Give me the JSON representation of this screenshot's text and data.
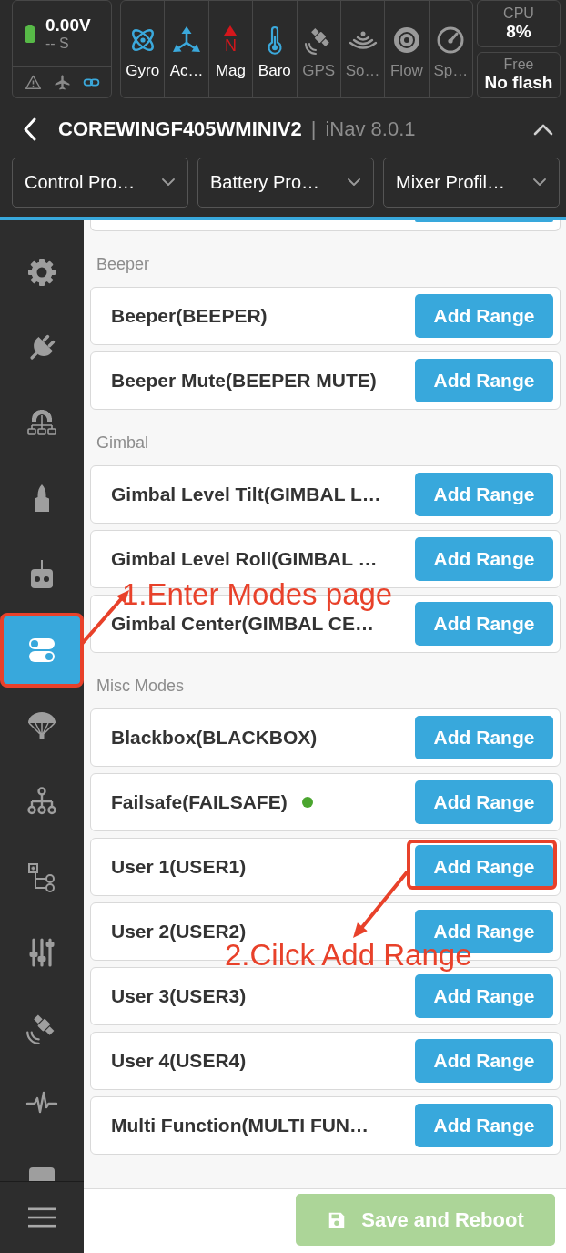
{
  "status": {
    "battery": {
      "voltage": "0.00V",
      "time": "-- S"
    },
    "indicators": [
      {
        "kind": "warning",
        "active": false
      },
      {
        "kind": "plane",
        "active": false
      },
      {
        "kind": "link",
        "active": true
      }
    ],
    "sensors": [
      {
        "kind": "atom",
        "label": "Gyro",
        "active": true
      },
      {
        "kind": "arrows",
        "label": "Ac…",
        "active": true
      },
      {
        "kind": "compass",
        "label": "Mag",
        "icon_text": "N",
        "active": true
      },
      {
        "kind": "thermometer",
        "label": "Baro",
        "active": true
      },
      {
        "kind": "satellite",
        "label": "GPS",
        "active": false
      },
      {
        "kind": "waves",
        "label": "So…",
        "active": false
      },
      {
        "kind": "disc",
        "label": "Flow",
        "active": false
      },
      {
        "kind": "gauge",
        "label": "Sp…",
        "active": false
      }
    ],
    "cpu": {
      "label": "CPU",
      "value": "8%"
    },
    "flash": {
      "label": "Free",
      "value": "No flash"
    }
  },
  "header": {
    "title": "COREWINGF405WMINIV2",
    "separator": "|",
    "version": "iNav 8.0.1"
  },
  "profiles": [
    {
      "label": "Control Pro…"
    },
    {
      "label": "Battery Pro…"
    },
    {
      "label": "Mixer Profil…"
    }
  ],
  "sidebar": {
    "items": [
      {
        "kind": "gear",
        "selected": false,
        "highlighted": false
      },
      {
        "kind": "plug",
        "selected": false,
        "highlighted": false
      },
      {
        "kind": "gear-network",
        "selected": false,
        "highlighted": false
      },
      {
        "kind": "rocket",
        "selected": false,
        "highlighted": false
      },
      {
        "kind": "remote",
        "selected": false,
        "highlighted": false
      },
      {
        "kind": "toggles",
        "selected": true,
        "highlighted": true
      },
      {
        "kind": "parachute",
        "selected": false,
        "highlighted": false
      },
      {
        "kind": "hierarchy",
        "selected": false,
        "highlighted": false
      },
      {
        "kind": "tree",
        "selected": false,
        "highlighted": false
      },
      {
        "kind": "sliders",
        "selected": false,
        "highlighted": false
      },
      {
        "kind": "satellite",
        "selected": false,
        "highlighted": false
      },
      {
        "kind": "pulse",
        "selected": false,
        "highlighted": false
      },
      {
        "kind": "badge",
        "selected": false,
        "highlighted": false
      }
    ]
  },
  "content": {
    "row_cut_at_top": true,
    "sections": [
      {
        "title": "Beeper",
        "modes": [
          {
            "label": "Beeper(BEEPER)",
            "button": "Add Range",
            "active": false,
            "highlighted": false
          },
          {
            "label": "Beeper Mute(BEEPER MUTE)",
            "button": "Add Range",
            "active": false,
            "highlighted": false
          }
        ]
      },
      {
        "title": "Gimbal",
        "modes": [
          {
            "label": "Gimbal Level Tilt(GIMBAL L…",
            "button": "Add Range",
            "active": false,
            "highlighted": false
          },
          {
            "label": "Gimbal Level Roll(GIMBAL …",
            "button": "Add Range",
            "active": false,
            "highlighted": false
          },
          {
            "label": "Gimbal Center(GIMBAL CE…",
            "button": "Add Range",
            "active": false,
            "highlighted": false
          }
        ]
      },
      {
        "title": "Misc Modes",
        "modes": [
          {
            "label": "Blackbox(BLACKBOX)",
            "button": "Add Range",
            "active": false,
            "highlighted": false
          },
          {
            "label": "Failsafe(FAILSAFE)",
            "button": "Add Range",
            "active": true,
            "highlighted": false
          },
          {
            "label": "User 1(USER1)",
            "button": "Add Range",
            "active": false,
            "highlighted": true
          },
          {
            "label": "User 2(USER2)",
            "button": "Add Range",
            "active": false,
            "highlighted": false
          },
          {
            "label": "User 3(USER3)",
            "button": "Add Range",
            "active": false,
            "highlighted": false
          },
          {
            "label": "User 4(USER4)",
            "button": "Add Range",
            "active": false,
            "highlighted": false
          },
          {
            "label": "Multi Function(MULTI FUN…",
            "button": "Add Range",
            "active": false,
            "highlighted": false
          }
        ]
      }
    ]
  },
  "footer": {
    "save_button": {
      "label": "Save and Reboot",
      "disabled": true
    }
  },
  "annotations": [
    {
      "text": "1.Enter Modes page"
    },
    {
      "text": "2.Cilck Add Range"
    }
  ]
}
